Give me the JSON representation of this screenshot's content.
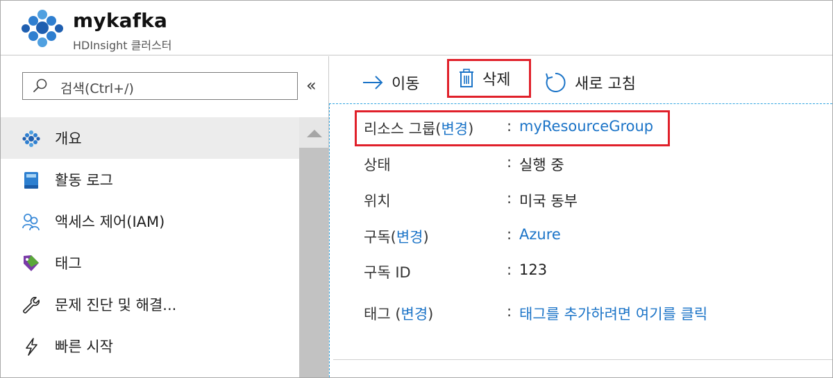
{
  "header": {
    "title": "mykafka",
    "subtitle": "HDInsight 클러스터",
    "logo_icon": "hdinsight-cluster-icon"
  },
  "sidebar": {
    "search_placeholder": "검색(Ctrl+/)",
    "collapse_label": "«",
    "items": [
      {
        "label": "개요",
        "icon": "overview-cluster-icon",
        "active": true
      },
      {
        "label": "활동 로그",
        "icon": "activity-log-book-icon",
        "active": false
      },
      {
        "label": "액세스 제어(IAM)",
        "icon": "people-icon",
        "active": false
      },
      {
        "label": "태그",
        "icon": "tag-icon",
        "active": false
      },
      {
        "label": "문제 진단 및 해결...",
        "icon": "wrench-icon",
        "active": false
      },
      {
        "label": "빠른 시작",
        "icon": "lightning-icon",
        "active": false
      }
    ]
  },
  "toolbar": {
    "move_label": "이동",
    "delete_label": "삭제",
    "refresh_label": "새로 고침"
  },
  "properties": {
    "resource_group": {
      "label": "리소스 그룹(",
      "change": "변경",
      "label_end": ")",
      "colon": ":",
      "value": "myResourceGroup"
    },
    "status": {
      "label": "상태",
      "colon": ":",
      "value": "실행 중"
    },
    "location": {
      "label": "위치",
      "colon": ":",
      "value": "미국 동부"
    },
    "subscription": {
      "label": "구독(",
      "change": "변경",
      "label_end": ")",
      "colon": ":",
      "value": "Azure"
    },
    "subscription_id": {
      "label": "구독 ID",
      "colon": ":",
      "value": "123"
    },
    "tags": {
      "label": "태그 (",
      "change": "변경",
      "label_end": ")",
      "colon": ":",
      "value": "태그를 추가하려면 여기를 클릭"
    }
  },
  "colors": {
    "accent_link": "#1a73c7",
    "highlight_red": "#e0202a",
    "dashed_border": "#2ea3e0"
  }
}
